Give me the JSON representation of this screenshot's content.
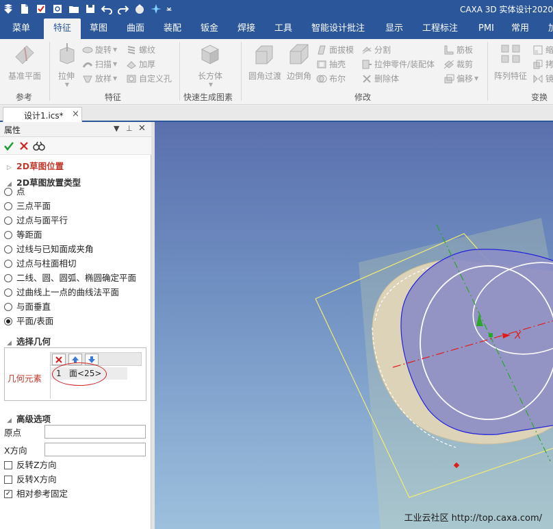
{
  "window": {
    "title": "CAXA 3D 实体设计2020"
  },
  "quick_access": [
    "app-logo-icon",
    "new-file-icon",
    "template-icon",
    "print-preview-icon",
    "open-folder-icon",
    "save-icon",
    "undo-icon",
    "redo-icon",
    "material-ball-icon",
    "smart-icon",
    "customize-dropdown-icon"
  ],
  "tabs": [
    "菜单",
    "特征",
    "草图",
    "曲面",
    "装配",
    "钣金",
    "焊接",
    "工具",
    "智能设计批注",
    "显示",
    "工程标注",
    "PMI",
    "常用",
    "加"
  ],
  "active_tab": "特征",
  "ribbon": {
    "groups": {
      "reference": "参考",
      "feature": "特征",
      "quick": "快速生成图素",
      "modify": "修改",
      "transform": "变换"
    },
    "buttons": {
      "datum_plane": "基准平面",
      "extrude": "拉伸",
      "revolve": "旋转",
      "sweep": "扫描",
      "loft": "放样",
      "thread": "螺纹",
      "thicken": "加厚",
      "custom_hole": "自定义孔",
      "cuboid": "长方体",
      "fillet": "圆角过渡",
      "chamfer": "边倒角",
      "draft": "面拔模",
      "shell": "抽壳",
      "boolean": "布尔",
      "split": "分割",
      "extrude_to_part": "拉伸零件/装配体",
      "delete_body": "删除体",
      "rib": "筋板",
      "trim": "裁剪",
      "offset": "偏移",
      "pattern": "阵列特征",
      "scale_short": "缩",
      "copy_short": "拷",
      "mirror_short": "镜"
    }
  },
  "document": {
    "tab_label": "设计1.ics*",
    "close": "×"
  },
  "panel": {
    "title": "属性",
    "header_icons": [
      "dropdown-icon",
      "pin-icon",
      "close-icon"
    ],
    "actions": [
      "confirm-icon",
      "cancel-icon",
      "preview-icon"
    ],
    "section_position": "2D草图位置",
    "section_type": "2D草图放置类型",
    "placement_options": [
      "点",
      "三点平面",
      "过点与面平行",
      "等距面",
      "过线与已知面成夹角",
      "过点与柱面相切",
      "二线、圆、圆弧、椭圆确定平面",
      "过曲线上一点的曲线法平面",
      "与面垂直",
      "平面/表面"
    ],
    "selected_option": "平面/表面",
    "section_geometry": "选择几何",
    "geometry_label": "几何元素",
    "geometry_rows": [
      {
        "index": "1",
        "value": "面<25>"
      }
    ],
    "section_advanced": "高级选项",
    "origin_label": "原点",
    "origin_value": "",
    "xdir_label": "X方向",
    "xdir_value": "",
    "checkboxes": [
      {
        "label": "反转Z方向",
        "checked": false
      },
      {
        "label": "反转X方向",
        "checked": false
      },
      {
        "label": "相对参考固定",
        "checked": true
      }
    ]
  },
  "viewport": {
    "axis_label": "X",
    "watermark": "工业云社区 http://top.caxa.com/",
    "colors": {
      "face": "#8c8ec4",
      "cylinder": "#dcd3b8",
      "plane": "#f2ec72",
      "axis_x": "#e01b1b",
      "axis_z": "#2aa62a"
    }
  },
  "colors": {
    "accent": "#2b579a",
    "ribbon_bg": "#f3f3f3",
    "red_text": "#c0392b"
  }
}
